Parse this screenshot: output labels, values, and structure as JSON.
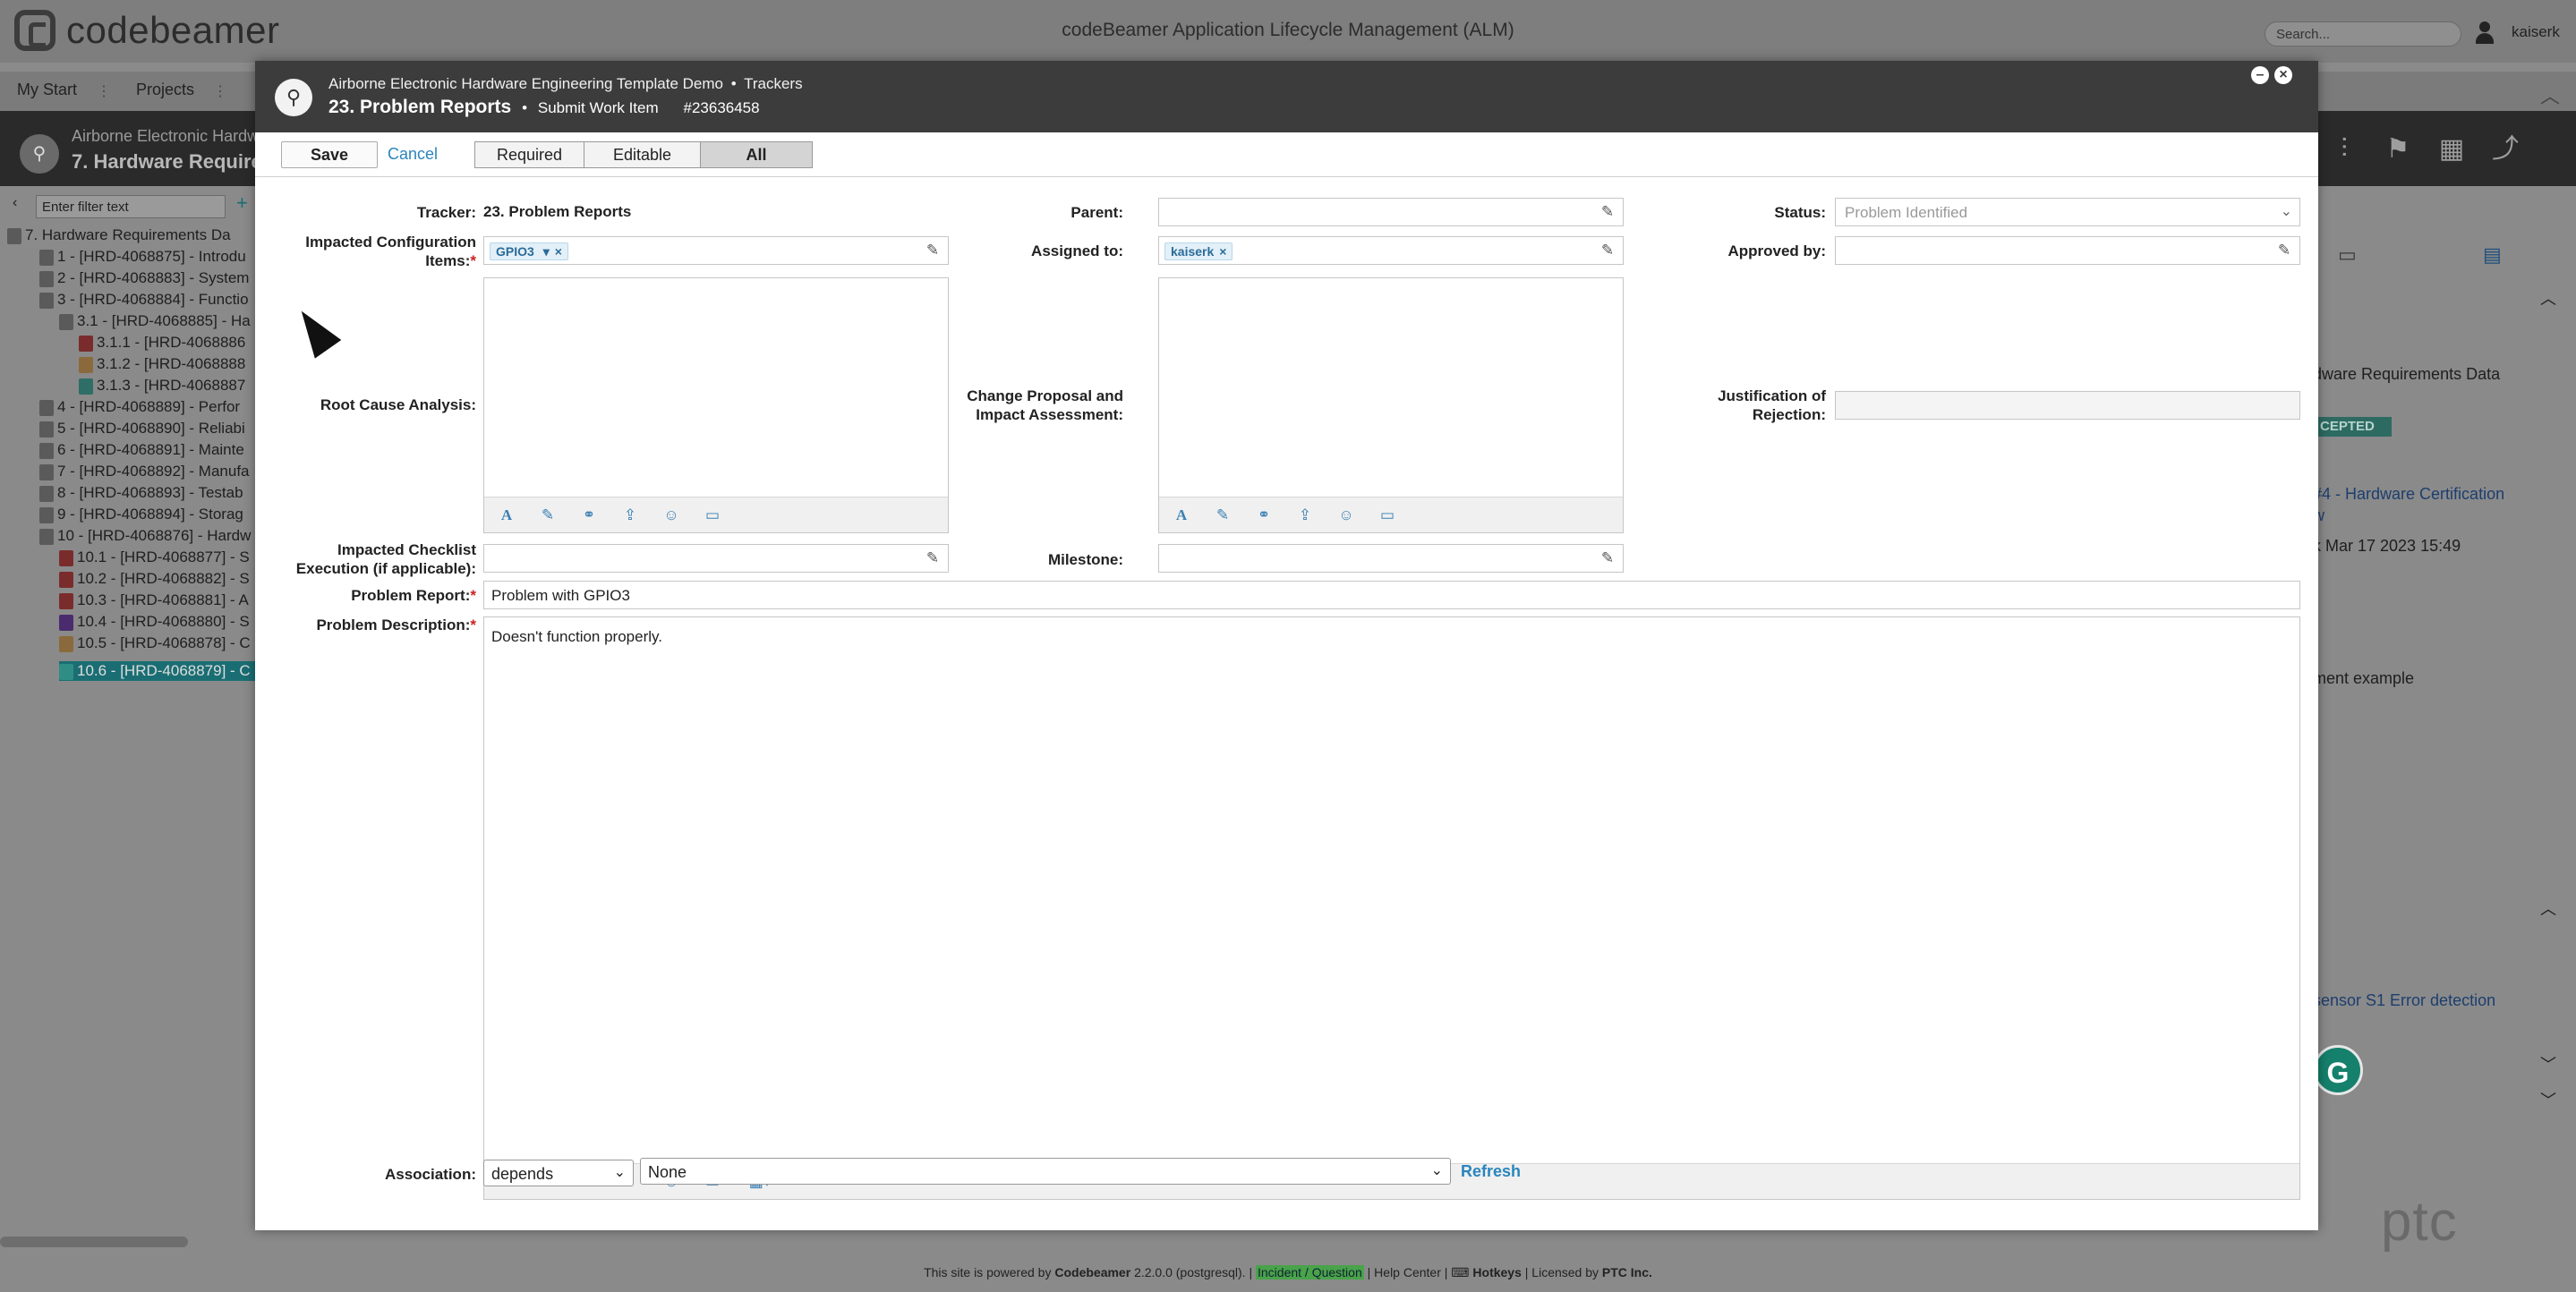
{
  "app": {
    "logo_text": "codebeamer",
    "window_title": "codeBeamer Application Lifecycle Management (ALM)",
    "search_placeholder": "Search...",
    "user": "kaiserk"
  },
  "nav": {
    "items": [
      "My Start",
      "Projects"
    ]
  },
  "project_header": {
    "line1": "Airborne Electronic Hardw",
    "line2": "7. Hardware Requiremen"
  },
  "left_panel": {
    "filter_placeholder": "Enter filter text",
    "tree": [
      {
        "text": "7. Hardware Requirements Da"
      },
      {
        "text": "1 - [HRD-4068875] - Introdu"
      },
      {
        "text": "2 - [HRD-4068883] - System"
      },
      {
        "text": "3 - [HRD-4068884] - Functio"
      },
      {
        "text": "3.1 - [HRD-4068885] - Ha"
      },
      {
        "text": "3.1.1 - [HRD-4068886"
      },
      {
        "text": "3.1.2 - [HRD-4068888"
      },
      {
        "text": "3.1.3 - [HRD-4068887"
      },
      {
        "text": "4 - [HRD-4068889] - Perfor"
      },
      {
        "text": "5 - [HRD-4068890] - Reliabi"
      },
      {
        "text": "6 - [HRD-4068891] - Mainte"
      },
      {
        "text": "7 - [HRD-4068892] - Manufa"
      },
      {
        "text": "8 - [HRD-4068893] - Testab"
      },
      {
        "text": "9 - [HRD-4068894] - Storag"
      },
      {
        "text": "10 - [HRD-4068876] - Hardw"
      },
      {
        "text": "10.1 - [HRD-4068877] - S"
      },
      {
        "text": "10.2 - [HRD-4068882] - S"
      },
      {
        "text": "10.3 - [HRD-4068881] - A"
      },
      {
        "text": "10.4 - [HRD-4068880] - S"
      },
      {
        "text": "10.5 - [HRD-4068878] - C"
      },
      {
        "text": "10.6 - [HRD-4068879] - C"
      }
    ]
  },
  "right_panel": {
    "text1": "dware Requirements Data",
    "badge": "CEPTED",
    "text2": "#4 - Hardware Certification",
    "text3": "w",
    "text4": "k Mar 17 2023 15:49",
    "text5": "ment example",
    "text6": "sensor S1 Error detection",
    "grammarly": "G",
    "ptc": "ptc"
  },
  "footer": {
    "prefix": "This site is powered by",
    "product": "Codebeamer",
    "version": "2.2.0.0 (postgresql).",
    "incident": "Incident / Question",
    "help": "Help Center",
    "hotkeys": "Hotkeys",
    "licensed": "Licensed by",
    "company": "PTC Inc."
  },
  "modal": {
    "breadcrumb": "Airborne Electronic Hardware Engineering Template Demo",
    "breadcrumb_sep": "•",
    "breadcrumb_2": "Trackers",
    "tracker_name": "23. Problem Reports",
    "title_sep": "•",
    "subtitle": "Submit Work Item",
    "item_id": "#23636458",
    "toolbar": {
      "save": "Save",
      "cancel": "Cancel",
      "filters": [
        "Required",
        "Editable",
        "All"
      ],
      "active_filter": "All"
    },
    "fields": {
      "tracker_label": "Tracker:",
      "tracker_value": "23. Problem Reports",
      "parent_label": "Parent:",
      "status_label": "Status:",
      "status_value": "Problem Identified",
      "impacted_ci_label": "Impacted Configuration Items:",
      "impacted_ci_tag": "GPIO3",
      "assigned_label": "Assigned to:",
      "assigned_tag": "kaiserk",
      "approved_label": "Approved by:",
      "root_cause_label": "Root Cause Analysis:",
      "change_proposal_label": "Change Proposal and Impact Assessment:",
      "justification_label": "Justification of Rejection:",
      "checklist_label": "Impacted Checklist Execution (if applicable):",
      "milestone_label": "Milestone:",
      "problem_report_label": "Problem Report:",
      "problem_report_value": "Problem with GPIO3",
      "problem_desc_label": "Problem Description:",
      "problem_desc_value": "Doesn't function properly.",
      "association_label": "Association:",
      "association_value": "depends",
      "association_target": "None",
      "refresh": "Refresh"
    }
  }
}
